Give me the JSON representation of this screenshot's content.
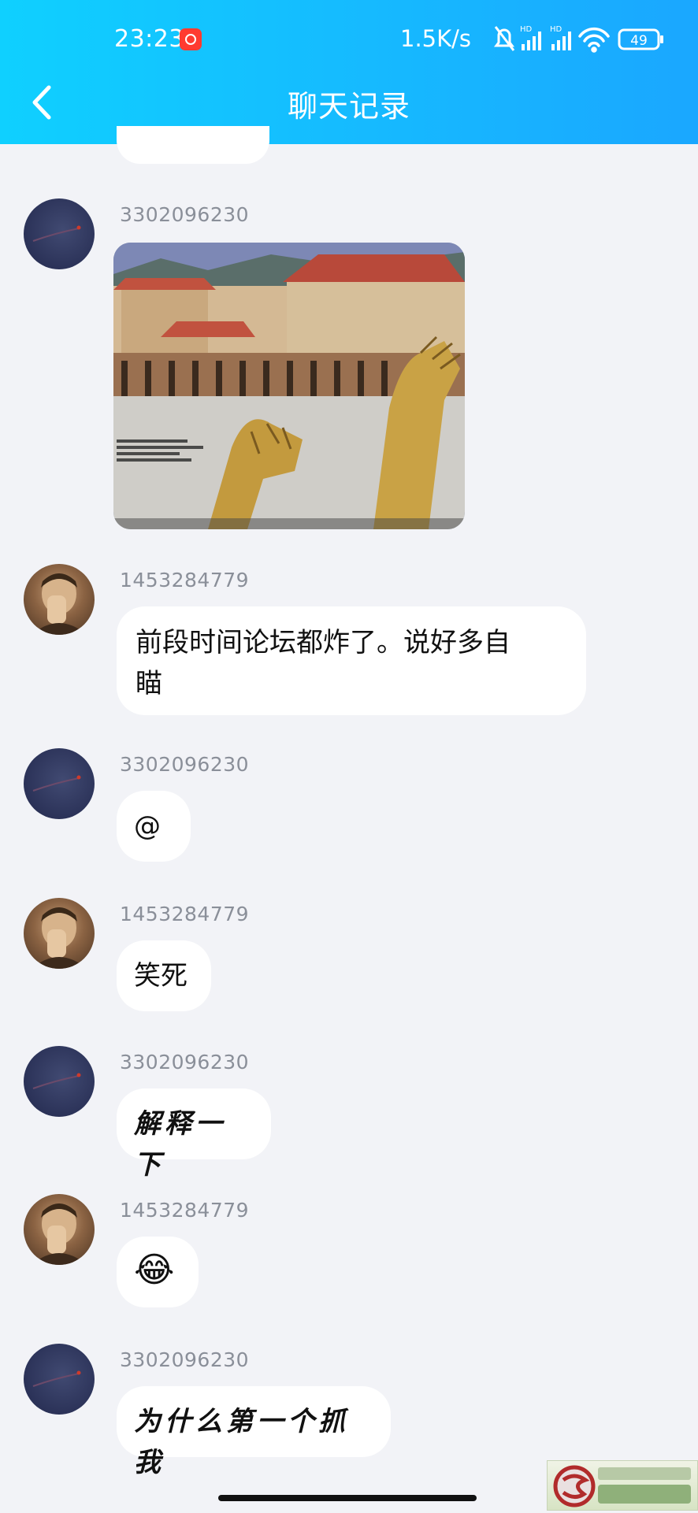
{
  "status_bar": {
    "time": "23:23",
    "network_speed": "1.5K/s",
    "signal_label_1": "HD",
    "signal_label_2": "HD",
    "battery": "49"
  },
  "header": {
    "title": "聊天记录",
    "back_icon": "chevron-left-icon"
  },
  "messages": [
    {
      "sender": "3302096230",
      "type": "image",
      "avatar": "night-sky-avatar",
      "image_desc_icon": "game-screenshot"
    },
    {
      "sender": "1453284779",
      "type": "text",
      "avatar": "portrait-avatar",
      "text_line1": "前段时间论坛都炸了。说好多自",
      "text_line2": "瞄"
    },
    {
      "sender": "3302096230",
      "type": "text",
      "avatar": "night-sky-avatar",
      "text": "@"
    },
    {
      "sender": "1453284779",
      "type": "text",
      "avatar": "portrait-avatar",
      "text": "笑死"
    },
    {
      "sender": "3302096230",
      "type": "text",
      "avatar": "night-sky-avatar",
      "text": "解释一下"
    },
    {
      "sender": "1453284779",
      "type": "emoji",
      "avatar": "portrait-avatar",
      "text": "😂"
    },
    {
      "sender": "3302096230",
      "type": "text",
      "avatar": "night-sky-avatar",
      "text": "为什么第一个抓我"
    }
  ],
  "colors": {
    "header_start": "#0fd0ff",
    "header_end": "#1aa7ff",
    "background": "#f2f3f7",
    "bubble": "#ffffff",
    "sender_text": "#8a8f99"
  }
}
